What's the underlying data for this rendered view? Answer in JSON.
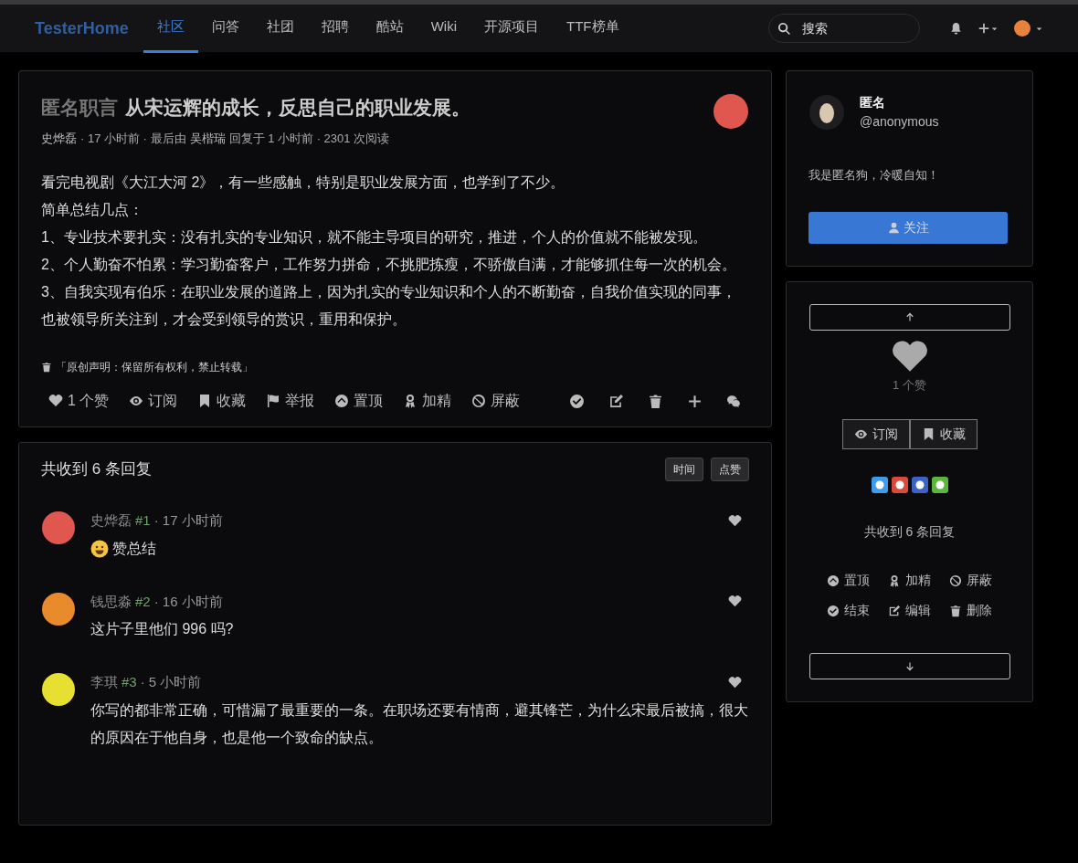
{
  "navbar": {
    "brand": "TesterHome",
    "items": [
      {
        "label": "社区",
        "selected": true
      },
      {
        "label": "问答",
        "selected": false
      },
      {
        "label": "社团",
        "selected": false
      },
      {
        "label": "招聘",
        "selected": false
      },
      {
        "label": "酷站",
        "selected": false
      },
      {
        "label": "Wiki",
        "selected": false
      },
      {
        "label": "开源项目",
        "selected": false
      },
      {
        "label": "TTF榜单",
        "selected": false
      }
    ],
    "search": {
      "placeholder": "搜索"
    }
  },
  "topic": {
    "category": "匿名职言",
    "title": "从宋运辉的成长，反思自己的职业发展。",
    "meta": [
      {
        "kind": "link",
        "text": "史烨磊"
      },
      {
        "kind": "text",
        "text": "· 17 小时前 · 最后由"
      },
      {
        "kind": "link",
        "text": "吴楷瑞"
      },
      {
        "kind": "text",
        "text": "回复于 1 小时前 · 2301 次阅读"
      }
    ],
    "body": [
      "看完电视剧《大江大河 2》，有一些感触，特别是职业发展方面，也学到了不少。",
      "简单总结几点：",
      "1、专业技术要扎实：没有扎实的专业知识，就不能主导项目的研究，推进，个人的价值就不能被发现。",
      "2、个人勤奋不怕累：学习勤奋客户，工作努力拼命，不挑肥拣瘦，不骄傲自满，才能够抓住每一次的机会。",
      "3、自我实现有伯乐：在职业发展的道路上，因为扎实的专业知识和个人的不断勤奋，自我价值实现的同事，也被领导所关注到，才会受到领导的赏识，重用和保护。"
    ],
    "copyright": "「原创声明：保留所有权利，禁止转载」",
    "actions": [
      {
        "kind": "heart",
        "label": "1 个赞"
      },
      {
        "kind": "eye",
        "label": "订阅"
      },
      {
        "kind": "bookmark",
        "label": "收藏"
      },
      {
        "kind": "flag",
        "label": "举报"
      },
      {
        "kind": "up",
        "label": "置顶"
      },
      {
        "kind": "award",
        "label": "加精"
      },
      {
        "kind": "ban",
        "label": "屏蔽"
      }
    ],
    "tools": [
      {
        "kind": "check"
      },
      {
        "kind": "edit"
      },
      {
        "kind": "trash"
      },
      {
        "kind": "plus"
      },
      {
        "kind": "wechat"
      }
    ]
  },
  "replies": {
    "title": "共收到 6 条回复",
    "sort_buttons": [
      "时间",
      "点赞"
    ],
    "items": [
      {
        "user": "史烨磊",
        "floor": "#1",
        "time": "· 17 小时前",
        "body": "赞总结",
        "emoji": true,
        "color": "#e0574f"
      },
      {
        "user": "钱思淼",
        "floor": "#2",
        "time": "· 16 小时前",
        "body": "这片子里他们 996 吗?",
        "emoji": false,
        "color": "#e98b2c"
      },
      {
        "user": "李琪",
        "floor": "#3",
        "time": "· 5 小时前",
        "body": "你写的都非常正确，可惜漏了最重要的一条。在职场还要有情商，避其锋芒，为什么宋最后被搞，很大的原因在于他自身，也是他一个致命的缺点。",
        "emoji": false,
        "color": "#e8e030"
      }
    ]
  },
  "sidebar": {
    "user": {
      "name": "匿名",
      "handle": "@anonymous",
      "bio": "我是匿名狗，冷暖自知！",
      "follow": "关注"
    },
    "likes": "1 个赞",
    "buttons": [
      {
        "kind": "eye",
        "label": "订阅"
      },
      {
        "kind": "bookmark",
        "label": "收藏"
      }
    ],
    "reply_count": "共收到 6 条回复",
    "admin": [
      {
        "kind": "up",
        "label": "置顶"
      },
      {
        "kind": "award",
        "label": "加精"
      },
      {
        "kind": "ban",
        "label": "屏蔽"
      },
      {
        "kind": "check",
        "label": "结束"
      },
      {
        "kind": "edit",
        "label": "编辑"
      },
      {
        "kind": "trash",
        "label": "删除"
      }
    ]
  }
}
